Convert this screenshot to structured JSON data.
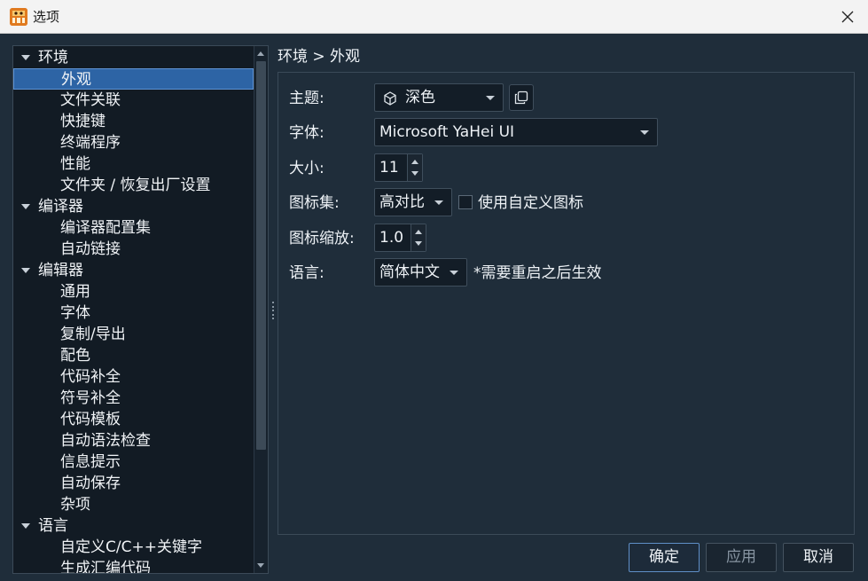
{
  "window": {
    "title": "选项",
    "close_glyph": "✕"
  },
  "tree": {
    "items": [
      {
        "label": "环境",
        "level": 0,
        "expanded": true
      },
      {
        "label": "外观",
        "level": 1,
        "selected": true
      },
      {
        "label": "文件关联",
        "level": 1
      },
      {
        "label": "快捷键",
        "level": 1
      },
      {
        "label": "终端程序",
        "level": 1
      },
      {
        "label": "性能",
        "level": 1
      },
      {
        "label": "文件夹 / 恢复出厂设置",
        "level": 1
      },
      {
        "label": "编译器",
        "level": 0,
        "expanded": true
      },
      {
        "label": "编译器配置集",
        "level": 1
      },
      {
        "label": "自动链接",
        "level": 1
      },
      {
        "label": "编辑器",
        "level": 0,
        "expanded": true
      },
      {
        "label": "通用",
        "level": 1
      },
      {
        "label": "字体",
        "level": 1
      },
      {
        "label": "复制/导出",
        "level": 1
      },
      {
        "label": "配色",
        "level": 1
      },
      {
        "label": "代码补全",
        "level": 1
      },
      {
        "label": "符号补全",
        "level": 1
      },
      {
        "label": "代码模板",
        "level": 1
      },
      {
        "label": "自动语法检查",
        "level": 1
      },
      {
        "label": "信息提示",
        "level": 1
      },
      {
        "label": "自动保存",
        "level": 1
      },
      {
        "label": "杂项",
        "level": 1
      },
      {
        "label": "语言",
        "level": 0,
        "expanded": true
      },
      {
        "label": "自定义C/C++关键字",
        "level": 1
      },
      {
        "label": "生成汇编代码",
        "level": 1
      }
    ]
  },
  "breadcrumb": "环境 > 外观",
  "settings": {
    "theme": {
      "label": "主题:",
      "value": "深色"
    },
    "font": {
      "label": "字体:",
      "value": "Microsoft YaHei UI"
    },
    "size": {
      "label": "大小:",
      "value": "11"
    },
    "icon_set": {
      "label": "图标集:",
      "value": "高对比",
      "custom_label": "使用自定义图标",
      "custom_checked": false
    },
    "icon_zoom": {
      "label": "图标缩放:",
      "value": "1.0"
    },
    "language": {
      "label": "语言:",
      "value": "简体中文",
      "note": "*需要重启之后生效"
    }
  },
  "buttons": {
    "ok": "确定",
    "apply": "应用",
    "cancel": "取消"
  },
  "colors": {
    "background": "#1f2d3a",
    "tree_background": "#121b24",
    "selection": "#2d64a5",
    "accent_border": "#5f8fc7"
  }
}
